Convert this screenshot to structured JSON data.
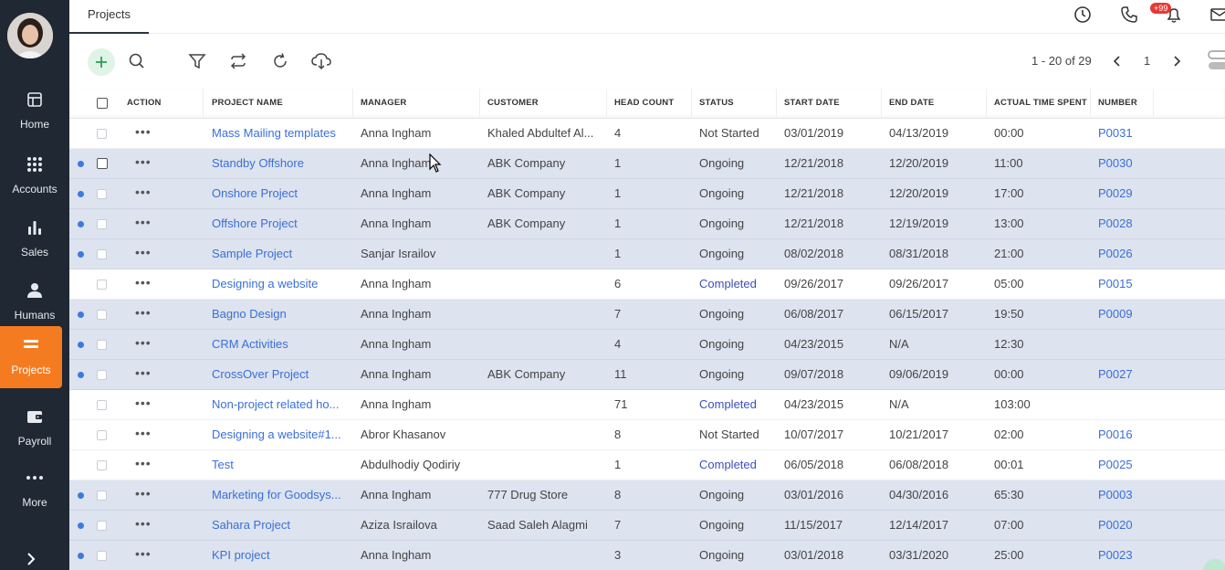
{
  "sidebar": {
    "items": [
      {
        "label": "Home",
        "icon": "home-icon"
      },
      {
        "label": "Accounts",
        "icon": "grid-icon"
      },
      {
        "label": "Sales",
        "icon": "bar-chart-icon"
      },
      {
        "label": "Humans",
        "icon": "person-icon"
      },
      {
        "label": "Projects",
        "icon": "projects-icon",
        "active": true
      },
      {
        "label": "Payroll",
        "icon": "wallet-icon"
      },
      {
        "label": "More",
        "icon": "more-icon"
      }
    ]
  },
  "topbar": {
    "tab": "Projects",
    "notification_badge": "+99"
  },
  "toolbar": {
    "pagination_text": "1 - 20 of 29",
    "current_page": "1"
  },
  "table": {
    "columns": [
      "ACTION",
      "PROJECT NAME",
      "MANAGER",
      "CUSTOMER",
      "HEAD COUNT",
      "STATUS",
      "START DATE",
      "END DATE",
      "ACTUAL TIME SPENT",
      "NUMBER"
    ],
    "rows": [
      {
        "unread": false,
        "name": "Mass Mailing templates",
        "manager": "Anna Ingham",
        "customer": "Khaled Abdultef Al...",
        "head": "4",
        "status": "Not Started",
        "start": "03/01/2019",
        "end": "04/13/2019",
        "time": "00:00",
        "number": "P0031"
      },
      {
        "unread": true,
        "name": "Standby Offshore",
        "manager": "Anna Ingham",
        "customer": "ABK Company",
        "head": "1",
        "status": "Ongoing",
        "start": "12/21/2018",
        "end": "12/20/2019",
        "time": "11:00",
        "number": "P0030"
      },
      {
        "unread": true,
        "name": "Onshore Project",
        "manager": "Anna Ingham",
        "customer": "ABK Company",
        "head": "1",
        "status": "Ongoing",
        "start": "12/21/2018",
        "end": "12/20/2019",
        "time": "17:00",
        "number": "P0029"
      },
      {
        "unread": true,
        "name": "Offshore Project",
        "manager": "Anna Ingham",
        "customer": "ABK Company",
        "head": "1",
        "status": "Ongoing",
        "start": "12/21/2018",
        "end": "12/19/2019",
        "time": "13:00",
        "number": "P0028"
      },
      {
        "unread": true,
        "name": "Sample Project",
        "manager": "Sanjar Israilov",
        "customer": "",
        "head": "1",
        "status": "Ongoing",
        "start": "08/02/2018",
        "end": "08/31/2018",
        "time": "21:00",
        "number": "P0026"
      },
      {
        "unread": false,
        "name": "Designing a website",
        "manager": "Anna Ingham",
        "customer": "",
        "head": "6",
        "status": "Completed",
        "start": "09/26/2017",
        "end": "09/26/2017",
        "time": "05:00",
        "number": "P0015"
      },
      {
        "unread": true,
        "name": "Bagno Design",
        "manager": "Anna Ingham",
        "customer": "",
        "head": "7",
        "status": "Ongoing",
        "start": "06/08/2017",
        "end": "06/15/2017",
        "time": "19:50",
        "number": "P0009"
      },
      {
        "unread": true,
        "name": "CRM Activities",
        "manager": "Anna Ingham",
        "customer": "",
        "head": "4",
        "status": "Ongoing",
        "start": "04/23/2015",
        "end": "N/A",
        "time": "12:30",
        "number": ""
      },
      {
        "unread": true,
        "name": "CrossOver Project",
        "manager": "Anna Ingham",
        "customer": "ABK Company",
        "head": "11",
        "status": "Ongoing",
        "start": "09/07/2018",
        "end": "09/06/2019",
        "time": "00:00",
        "number": "P0027"
      },
      {
        "unread": false,
        "name": "Non-project related ho...",
        "manager": "Anna Ingham",
        "customer": "",
        "head": "71",
        "status": "Completed",
        "start": "04/23/2015",
        "end": "N/A",
        "time": "103:00",
        "number": ""
      },
      {
        "unread": false,
        "name": "Designing a website#1...",
        "manager": "Abror Khasanov",
        "customer": "",
        "head": "8",
        "status": "Not Started",
        "start": "10/07/2017",
        "end": "10/21/2017",
        "time": "02:00",
        "number": "P0016"
      },
      {
        "unread": false,
        "name": "Test",
        "manager": "Abdulhodiy Qodiriy",
        "customer": "",
        "head": "1",
        "status": "Completed",
        "start": "06/05/2018",
        "end": "06/08/2018",
        "time": "00:01",
        "number": "P0025"
      },
      {
        "unread": true,
        "name": "Marketing for Goodsys...",
        "manager": "Anna Ingham",
        "customer": "777 Drug Store",
        "head": "8",
        "status": "Ongoing",
        "start": "03/01/2016",
        "end": "04/30/2016",
        "time": "65:30",
        "number": "P0003"
      },
      {
        "unread": true,
        "name": "Sahara Project",
        "manager": "Aziza Israilova",
        "customer": "Saad Saleh Alagmi",
        "head": "7",
        "status": "Ongoing",
        "start": "11/15/2017",
        "end": "12/14/2017",
        "time": "07:00",
        "number": "P0020"
      },
      {
        "unread": true,
        "name": "KPI project",
        "manager": "Anna Ingham",
        "customer": "",
        "head": "3",
        "status": "Ongoing",
        "start": "03/01/2018",
        "end": "03/31/2020",
        "time": "25:00",
        "number": "P0023"
      }
    ]
  },
  "colors": {
    "sidebar_bg": "#1f2833",
    "active_nav": "#f47b20",
    "link": "#3a6fd8",
    "unread_row": "#dde3ef",
    "unread_dot": "#3a7be0",
    "badge": "#e53935"
  }
}
